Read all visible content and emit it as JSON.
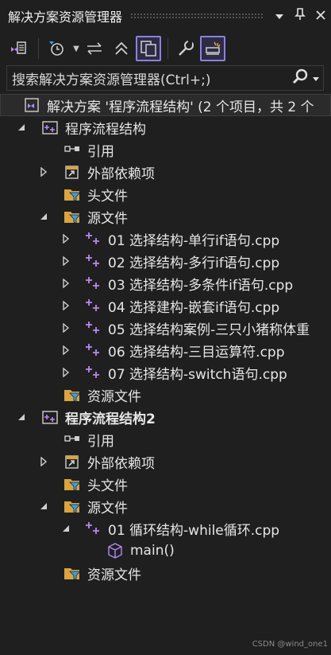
{
  "titlebar": {
    "title": "解决方案资源管理器",
    "icons": [
      "dropdown-icon",
      "pin-icon",
      "close-icon"
    ]
  },
  "toolbar": {
    "buttons": [
      "switch-views-icon",
      "history-icon",
      "sync-icon",
      "collapse-all-icon",
      "show-all-files-icon",
      "properties-icon",
      "preview-icon"
    ]
  },
  "search": {
    "placeholder": "搜索解决方案资源管理器(Ctrl+;)"
  },
  "solution": {
    "label": "解决方案 '程序流程结构' (2 个项目，共 2 个"
  },
  "projects": [
    {
      "name": "程序流程结构",
      "references": "引用",
      "external_deps": "外部依赖项",
      "headers": "头文件",
      "sources": "源文件",
      "source_files": [
        "01 选择结构-单行if语句.cpp",
        "02 选择结构-多行if语句.cpp",
        "03 选择结构-多条件if语句.cpp",
        "04 选择建构-嵌套if语句.cpp",
        "05 选择结构案例-三只小猪称体重",
        "06 选择结构-三目运算符.cpp",
        "07 选择结构-switch语句.cpp"
      ],
      "resources": "资源文件"
    },
    {
      "name": "程序流程结构2",
      "references": "引用",
      "external_deps": "外部依赖项",
      "headers": "头文件",
      "sources": "源文件",
      "source_files": [
        "01 循环结构-while循环.cpp"
      ],
      "function": "main()",
      "resources": "资源文件"
    }
  ],
  "watermark": "CSDN @wind_one1",
  "colors": {
    "background": "#1f1f1f",
    "accent": "#8a82e0",
    "cpp_icon": "#b48cf0",
    "folder": "#d9a441",
    "filter": "#3aa0e8"
  }
}
